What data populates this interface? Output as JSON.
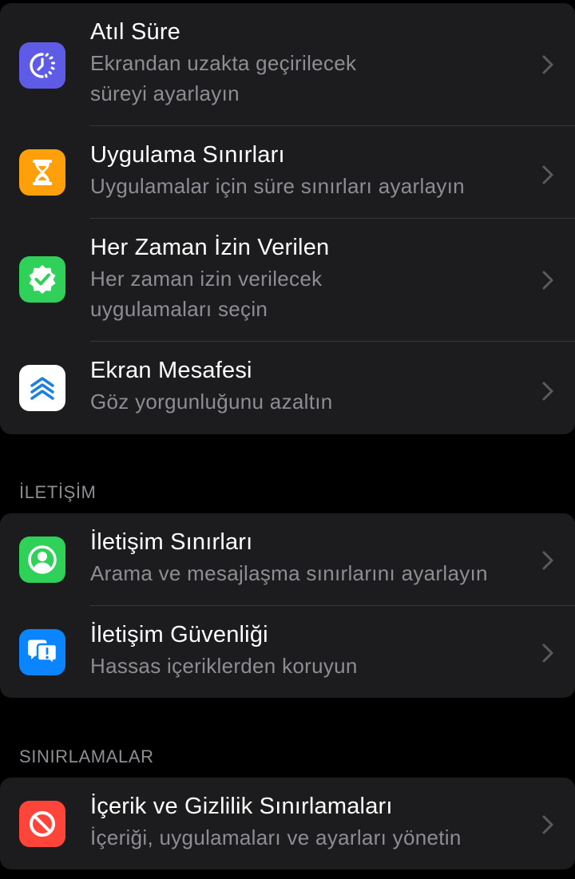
{
  "groups": {
    "screen_time": {
      "rows": [
        {
          "title": "Atıl Süre",
          "subtitle": "Ekrandan uzakta geçirilecek süreyi ayarlayın",
          "icon": "downtime-icon",
          "icon_bg": "#5e5ce6"
        },
        {
          "title": "Uygulama Sınırları",
          "subtitle": "Uygulamalar için süre sınırları ayarlayın",
          "icon": "hourglass-icon",
          "icon_bg": "#ff9f0a"
        },
        {
          "title": "Her Zaman İzin Verilen",
          "subtitle": "Her zaman izin verilecek uygulamaları seçin",
          "icon": "checkmark-seal-icon",
          "icon_bg": "#30d158"
        },
        {
          "title": "Ekran Mesafesi",
          "subtitle": "Göz yorgunluğunu azaltın",
          "icon": "chevrons-up-icon",
          "icon_bg": "#ffffff"
        }
      ]
    },
    "communication": {
      "header": "İLETİŞİM",
      "rows": [
        {
          "title": "İletişim Sınırları",
          "subtitle": "Arama ve mesajlaşma sınırlarını ayarlayın",
          "icon": "person-circle-icon",
          "icon_bg": "#30d158"
        },
        {
          "title": "İletişim Güvenliği",
          "subtitle": "Hassas içeriklerden koruyun",
          "icon": "message-alert-icon",
          "icon_bg": "#0a84ff"
        }
      ]
    },
    "restrictions": {
      "header": "SINIRLAMALAR",
      "rows": [
        {
          "title": "İçerik ve Gizlilik Sınırlamaları",
          "subtitle": "İçeriği, uygulamaları ve ayarları yönetin",
          "icon": "prohibited-icon",
          "icon_bg": "#ff453a"
        }
      ]
    }
  },
  "colors": {
    "background": "#000000",
    "cell": "#1c1c1e",
    "separator": "#38383a",
    "primary_text": "#ffffff",
    "secondary_text": "#8d8d93",
    "chevron": "#5a5a5f"
  }
}
